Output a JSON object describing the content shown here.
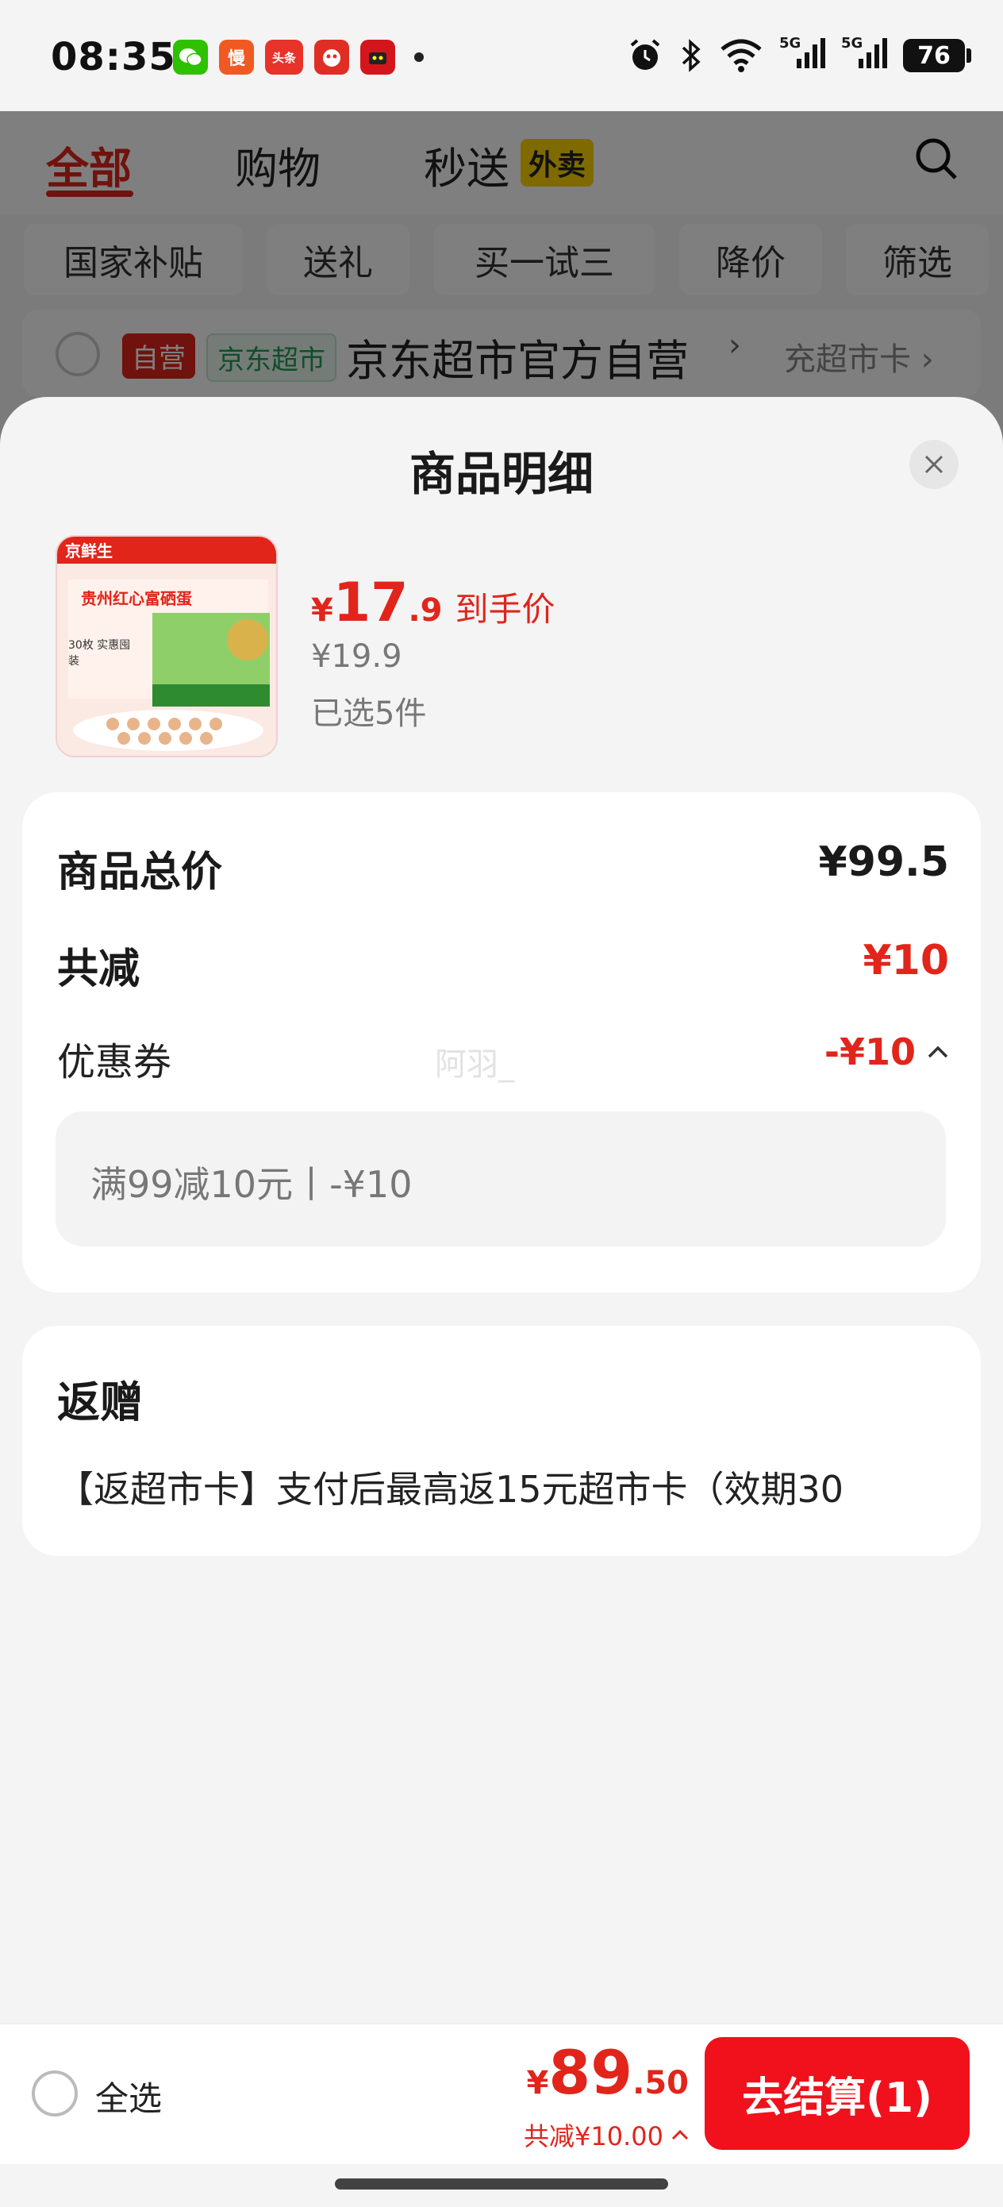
{
  "status_bar": {
    "time": "08:35",
    "notification_apps": [
      "wechat-icon",
      "man-icon",
      "toutiao-icon",
      "pinduoduo-icon",
      "tmall-icon"
    ],
    "app_labels": {
      "man": "慢",
      "toutiao": "头条"
    },
    "signal_1": "5G",
    "signal_2": "5G",
    "battery": "76"
  },
  "background": {
    "tabs": [
      {
        "label": "全部",
        "active": true
      },
      {
        "label": "购物"
      },
      {
        "label": "秒送"
      }
    ],
    "waimai_badge": "外卖",
    "chips": [
      "国家补贴",
      "送礼",
      "买一试三",
      "降价",
      "筛选"
    ],
    "store": {
      "self_operated": "自营",
      "jd_supermarket": "京东超市",
      "name": "京东超市官方自营",
      "chevron": "›",
      "recharge": "充超市卡 ›"
    }
  },
  "sheet": {
    "title": "商品明细",
    "product": {
      "image_brand": "京鲜生",
      "image_title": "贵州红心富硒蛋",
      "image_badge": "30枚 实惠囤装",
      "currency": "¥",
      "price_int": "17",
      "price_dec": ".9",
      "price_tag": "到手价",
      "original_price": "¥19.9",
      "selected": "已选5件"
    },
    "summary": {
      "total_label": "商品总价",
      "total_value": "¥99.5",
      "reduce_label": "共减",
      "reduce_value": "¥10",
      "coupon_label": "优惠券",
      "coupon_value": "-¥10",
      "watermark": "阿羽_",
      "coupon_detail": "满99减10元丨-¥10"
    },
    "gift": {
      "title": "返赠",
      "desc": "【返超市卡】支付后最高返15元超市卡（效期30"
    }
  },
  "bottom_bar": {
    "select_all": "全选",
    "currency": "¥",
    "total_int": "89",
    "total_dec": ".50",
    "discount": "共减¥10.00",
    "checkout": "去结算(1)"
  },
  "colors": {
    "accent": "#e1251b",
    "checkout": "#f0111c",
    "sheet_bg": "#f4f4f4"
  }
}
